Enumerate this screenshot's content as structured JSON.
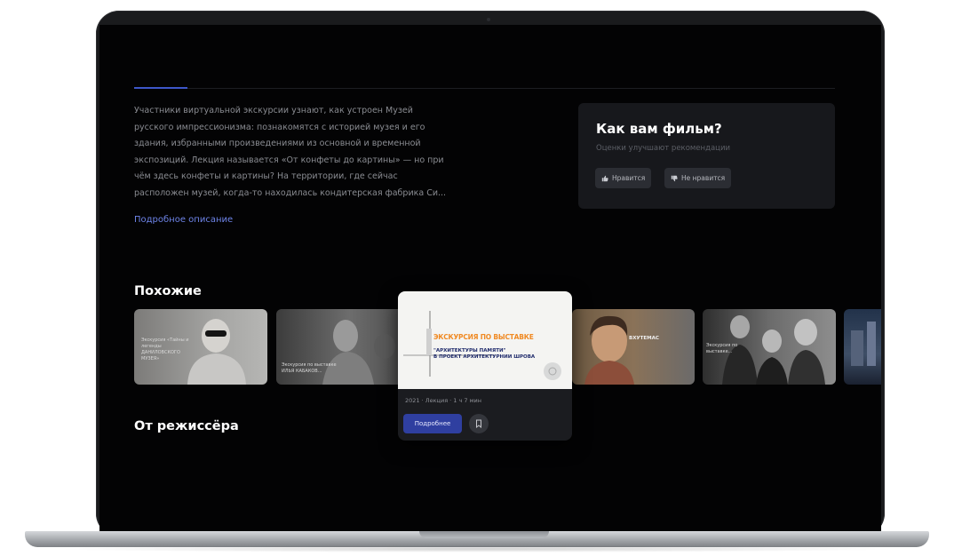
{
  "description": {
    "lines": [
      "Участники виртуальной экскурсии узнают, как устроен Музей",
      "русского импрессионизма: познакомятся с историей музея и его",
      "здания, избранными произведениями из основной и временной",
      "экспозиций. Лекция называется «От конфеты до картины» — но при",
      "чём здесь конфеты и картины? На территории, где сейчас",
      "расположен музей, когда-то находилась кондитерская фабрика Си..."
    ],
    "more_link": "Подробное описание"
  },
  "rating": {
    "title": "Как вам фильм?",
    "subtitle": "Оценки улучшают рекомендации",
    "like_label": "Нравится",
    "dislike_label": "Не нравится"
  },
  "similar": {
    "title": "Похожие",
    "items": [
      {
        "caption": "Экскурсия «Тайны и легенды ДАНИЛОВСКОГО МУЗЕЯ»"
      },
      {
        "caption": "Экскурсия по выставке ИЛЬЯ КАБАКОВ..."
      },
      {
        "caption_1": "ЭКСКУРСИЯ ПО ВЫСТАВКЕ",
        "caption_2": "\"АРХИТЕКТУРЫ ПАМЯТИ\"",
        "caption_3": "В ПРОЕКТ АРХИТЕКТУРНИИ ШРОВА",
        "meta": "2021 · Лекция · 1 ч 7 мин",
        "details_label": "Подробнее"
      },
      {
        "caption": "ВХУТЕМАС"
      },
      {
        "caption": "Экскурсия по выставке..."
      }
    ]
  },
  "director": {
    "title": "От режиссёра"
  },
  "colors": {
    "accent": "#3d57c9",
    "link": "#6e84e8",
    "primary_button": "#2f3fa0",
    "highlight_text": "#f08a24"
  }
}
